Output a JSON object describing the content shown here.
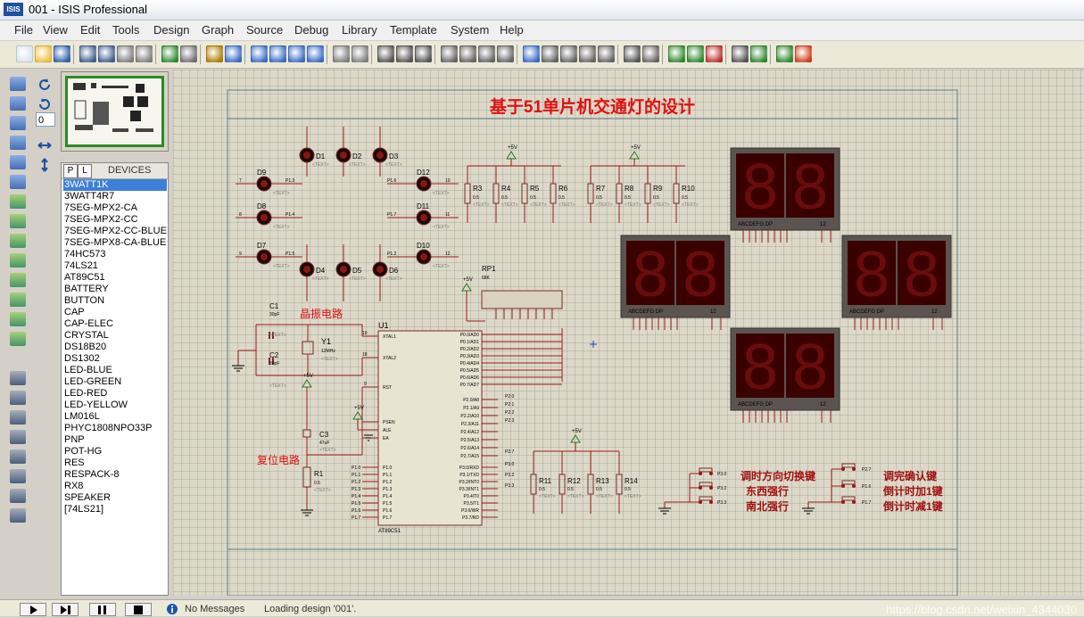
{
  "window": {
    "icon_text": "ISIS",
    "title": "001 - ISIS Professional"
  },
  "menu": [
    "File",
    "View",
    "Edit",
    "Tools",
    "Design",
    "Graph",
    "Source",
    "Debug",
    "Library",
    "Template",
    "System",
    "Help"
  ],
  "rotation_value": "0",
  "devices": {
    "tab_p": "P",
    "tab_l": "L",
    "header": "DEVICES",
    "items": [
      "3WATT1K",
      "3WATT4R7",
      "7SEG-MPX2-CA",
      "7SEG-MPX2-CC",
      "7SEG-MPX2-CC-BLUE",
      "7SEG-MPX8-CA-BLUE",
      "74HC573",
      "74LS21",
      "AT89C51",
      "BATTERY",
      "BUTTON",
      "CAP",
      "CAP-ELEC",
      "CRYSTAL",
      "DS18B20",
      "DS1302",
      "LED-BLUE",
      "LED-GREEN",
      "LED-RED",
      "LED-YELLOW",
      "LM016L",
      "PHYC1808NPO33P",
      "PNP",
      "POT-HG",
      "RES",
      "RESPACK-8",
      "RX8",
      "SPEAKER",
      "[74LS21]"
    ],
    "selected_index": 0
  },
  "schematic": {
    "title": "基于51单片机交通灯的设计",
    "leds": [
      "D1",
      "D2",
      "D3",
      "D4",
      "D5",
      "D6",
      "D7",
      "D8",
      "D9",
      "D10",
      "D11",
      "D12"
    ],
    "resistors_top": [
      "R3",
      "R4",
      "R5",
      "R6",
      "R7",
      "R8",
      "R9",
      "R10"
    ],
    "resistors_bottom": [
      "R11",
      "R12",
      "R13",
      "R14"
    ],
    "res_value": "0.5",
    "vcc": "+5V",
    "text_placeholder": "<TEXT>",
    "rp1": "RP1",
    "rp1_value": "68K",
    "u1": "U1",
    "u1_part": "AT89C51",
    "crystal": "Y1",
    "crystal_value": "12MHz",
    "c1": "C1",
    "c2": "C2",
    "c3": "C3",
    "cap_value": "30pF",
    "c3_value": "47uF",
    "r1": "R1",
    "label_oscillator": "晶振电路",
    "label_reset": "复位电路",
    "mcu_left_pins": [
      "XTAL1",
      "XTAL2",
      "RST",
      "PSEN",
      "ALE",
      "EA",
      "P1.0",
      "P1.1",
      "P1.2",
      "P1.3",
      "P1.4",
      "P1.5",
      "P1.6",
      "P1.7"
    ],
    "mcu_right_pins": [
      "P0.0/AD0",
      "P0.1/AD1",
      "P0.2/AD2",
      "P0.3/AD3",
      "P0.4/AD4",
      "P0.5/AD5",
      "P0.6/AD6",
      "P0.7/AD7",
      "P2.0/A8",
      "P2.1/A9",
      "P2.2/A10",
      "P2.3/A11",
      "P2.4/A12",
      "P2.5/A13",
      "P2.6/A14",
      "P2.7/A15",
      "P3.0/RXD",
      "P3.1/TXD",
      "P3.2/INT0",
      "P3.3/INT1",
      "P3.4/T0",
      "P3.5/T1",
      "P3.6/WR",
      "P3.7/RD"
    ],
    "seg_label": "ABCDEFG  DP",
    "seg_digits": "88",
    "buttons_left": [
      "调时方向切换键",
      "东西强行",
      "南北强行"
    ],
    "buttons_right": [
      "调完确认键",
      "倒计时加1键",
      "倒计时减1键"
    ],
    "btn_pins_left": [
      "P3.0",
      "P3.2",
      "P3.3"
    ],
    "btn_pins_right": [
      "P2.7",
      "P1.6",
      "P1.7"
    ]
  },
  "status": {
    "messages": "No Messages",
    "text": "Loading design '001'.",
    "watermark": "https://blog.csdn.net/weixin_4344030"
  },
  "colors": {
    "canvas": "#ddd9c8",
    "wire": "#9a1a1a",
    "title_red": "#e01010",
    "seg_on": "#5a0a0a"
  }
}
